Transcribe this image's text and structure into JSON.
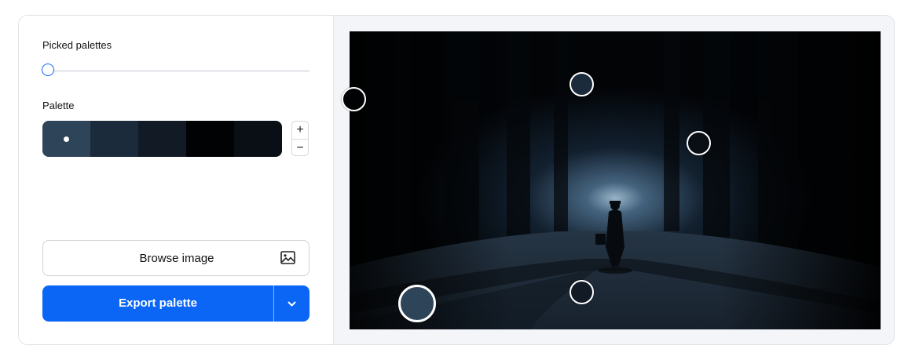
{
  "controls": {
    "picked_palettes_label": "Picked palettes",
    "picked_palettes_level": 0,
    "palette_label": "Palette",
    "add_label": "+",
    "remove_label": "−",
    "browse_label": "Browse image",
    "export_label": "Export palette"
  },
  "palette": {
    "colors": [
      "#2e4459",
      "#1c2b3b",
      "#111a25",
      "#010203",
      "#0a0f16"
    ],
    "selected_index": 0
  },
  "pickers": [
    {
      "color": "#010203"
    },
    {
      "color": "#1c2b3b"
    },
    {
      "color": "#0a0f16"
    },
    {
      "color": "#2e4459"
    },
    {
      "color": "#111a25"
    }
  ],
  "accent": "#0b66f6",
  "icons": {
    "browse": "image-icon",
    "export_dropdown": "chevron-down-icon"
  }
}
